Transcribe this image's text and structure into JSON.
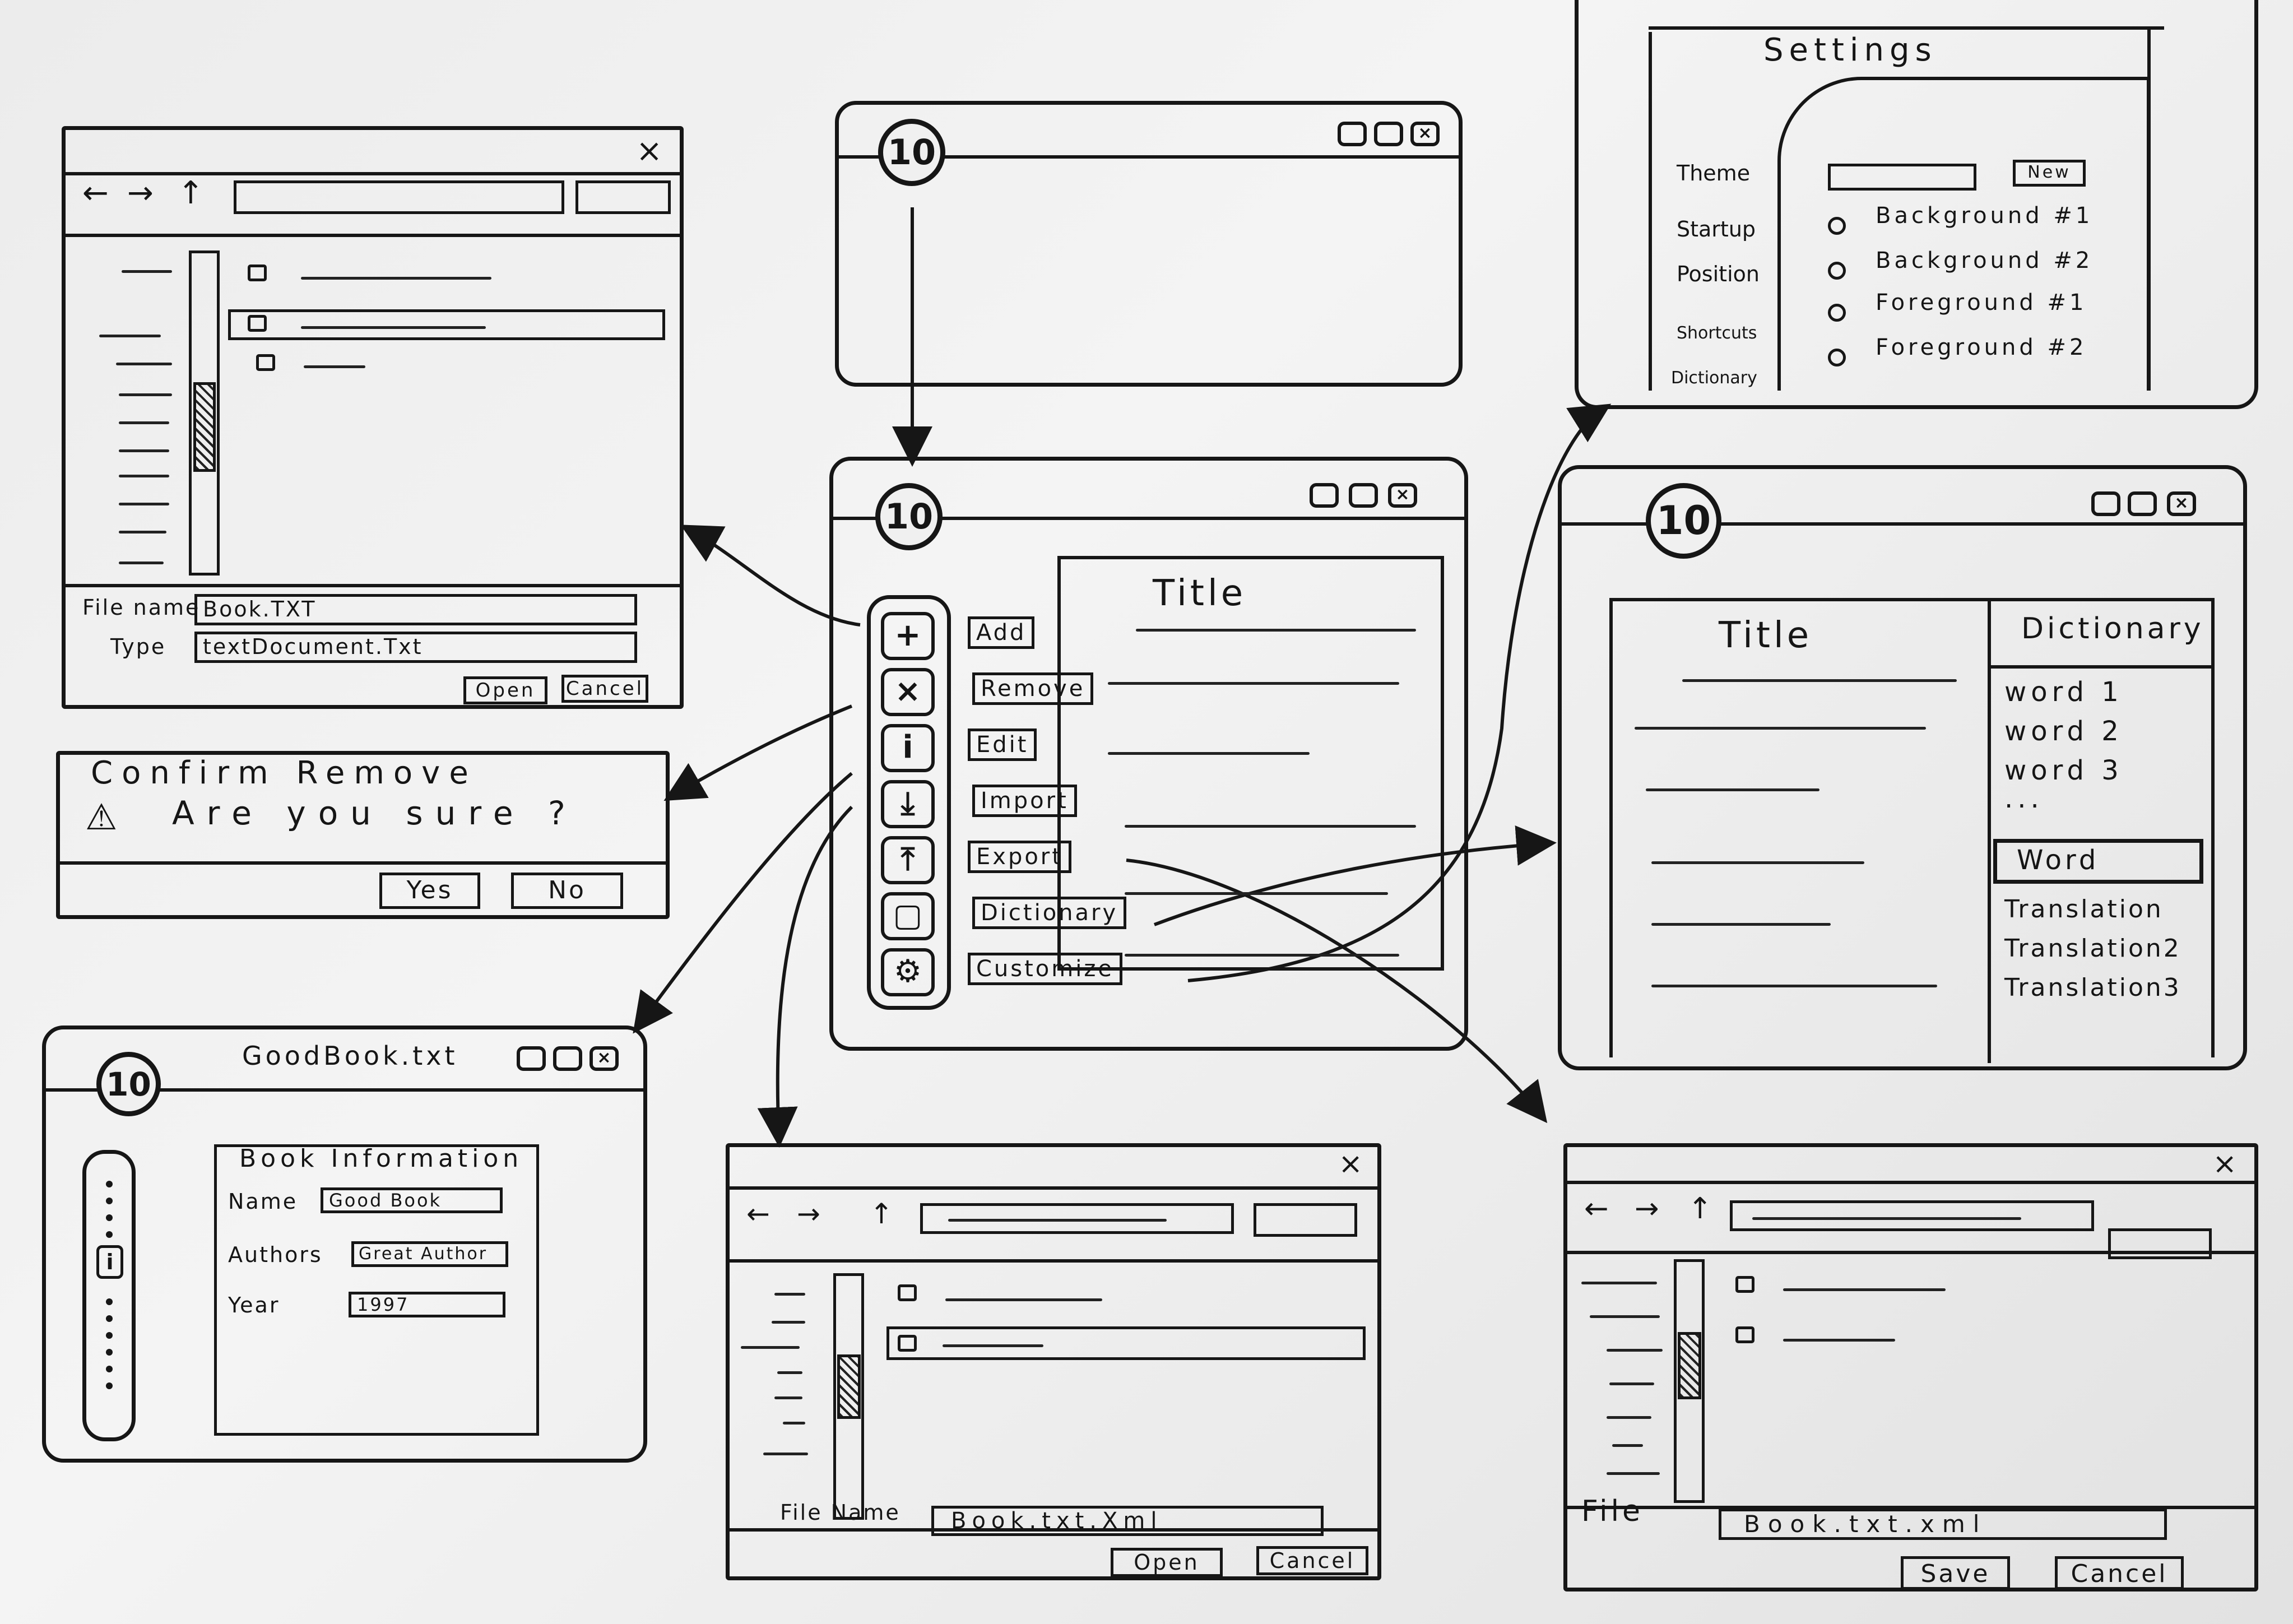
{
  "main_window": {
    "logo": "10",
    "controls": [
      "min-icon",
      "restore-icon",
      "close-icon"
    ],
    "tools": [
      {
        "icon": "plus-icon",
        "glyph": "+",
        "label": "Add"
      },
      {
        "icon": "remove-icon",
        "glyph": "×",
        "label": "Remove"
      },
      {
        "icon": "info-icon",
        "glyph": "i",
        "label": "Edit"
      },
      {
        "icon": "import-icon",
        "glyph": "⤓",
        "label": "Import"
      },
      {
        "icon": "export-icon",
        "glyph": "⤒",
        "label": "Export"
      },
      {
        "icon": "book-icon",
        "glyph": "▢",
        "label": "Dictionary"
      },
      {
        "icon": "gear-icon",
        "glyph": "⚙",
        "label": "Customize"
      }
    ],
    "content_title": "Title"
  },
  "splash_window": {
    "logo": "10"
  },
  "open_dialog_top": {
    "close": "×",
    "filename_label": "File name",
    "filename_value": "Book.TXT",
    "type_label": "Type",
    "type_value": "textDocument.Txt",
    "open_button": "Open",
    "cancel_button": "Cancel"
  },
  "confirm_dialog": {
    "title": "Confirm Remove",
    "message": "Are you sure ?",
    "yes_button": "Yes",
    "no_button": "No"
  },
  "book_window": {
    "logo": "10",
    "title": "GoodBook.txt",
    "section_title": "Book Information",
    "name_label": "Name",
    "name_value": "Good Book",
    "authors_label": "Authors",
    "authors_value": "Great Author",
    "year_label": "Year",
    "year_value": "1997"
  },
  "import_dialog": {
    "close": "×",
    "filename_label": "File Name",
    "filename_value": "Book.txt.Xml",
    "open_button": "Open",
    "cancel_button": "Cancel"
  },
  "export_dialog": {
    "close": "×",
    "file_label": "File",
    "file_value": "Book.txt.xml",
    "save_button": "Save",
    "cancel_button": "Cancel"
  },
  "settings_window": {
    "title": "Settings",
    "nav": [
      "Theme",
      "Startup",
      "Position",
      "Shortcuts",
      "Dictionary"
    ],
    "new_button": "New",
    "options": [
      "Background #1",
      "Background #2",
      "Foreground #1",
      "Foreground #2"
    ]
  },
  "dictionary_window": {
    "logo": "10",
    "content_title": "Title",
    "panel_title": "Dictionary",
    "words": [
      "word 1",
      "word 2",
      "word 3",
      "..."
    ],
    "word_input": "Word",
    "translations": [
      "Translation",
      "Translation2",
      "Translation3"
    ]
  }
}
